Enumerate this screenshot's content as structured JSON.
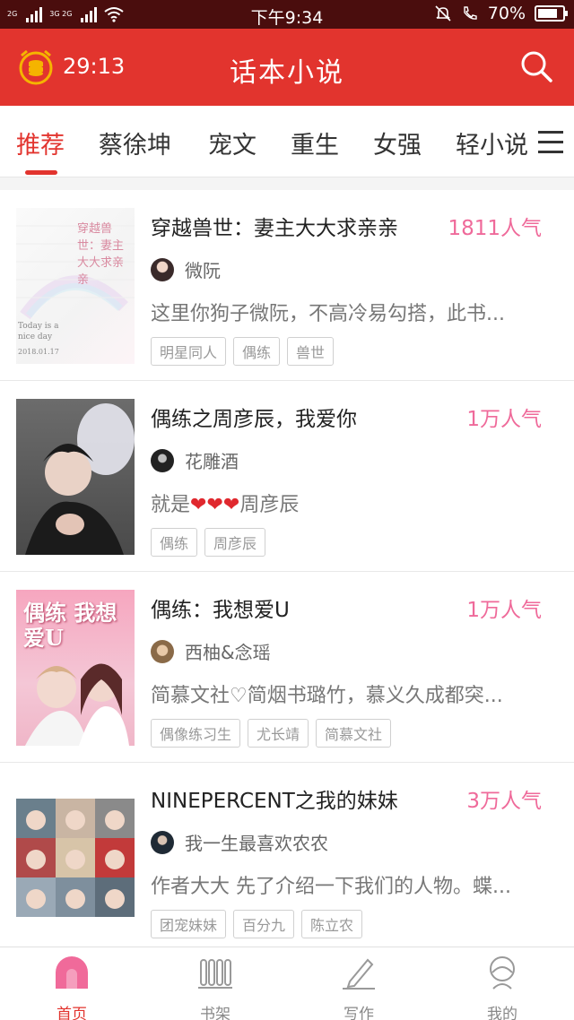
{
  "status": {
    "network_top": "2G",
    "network_bottom": "3G 2G",
    "time": "下午9:34",
    "battery": "70%"
  },
  "header": {
    "timer": "29:13",
    "title": "话本小说"
  },
  "tabs": [
    {
      "label": "推荐",
      "active": true
    },
    {
      "label": "蔡徐坤"
    },
    {
      "label": "宠文"
    },
    {
      "label": "重生"
    },
    {
      "label": "女强"
    },
    {
      "label": "轻小说"
    }
  ],
  "books": [
    {
      "title": "穿越兽世：妻主大大求亲亲",
      "popularity": "1811人气",
      "author": "微阮",
      "desc": "这里你狗子微阮，不高冷易勾搭，此书...",
      "tags": [
        "明星同人",
        "偶练",
        "兽世"
      ],
      "cover_text": [
        "穿越兽世：妻主大大求亲亲",
        "Today is a nice day",
        "2018.01.17"
      ]
    },
    {
      "title": "偶练之周彦辰，我爱你",
      "popularity": "1万人气",
      "author": "花雕酒",
      "desc_prefix": "就是",
      "desc_hearts": "❤❤❤",
      "desc_suffix": "周彦辰",
      "tags": [
        "偶练",
        "周彦辰"
      ]
    },
    {
      "title": "偶练：我想爱U",
      "popularity": "1万人气",
      "author": "西柚&念瑶",
      "desc": "简慕文社♡简烟书璐竹，慕义久成都突...",
      "tags": [
        "偶像练习生",
        "尤长靖",
        "简慕文社"
      ],
      "cover_text": "偶练 我想爱U"
    },
    {
      "title": "NINEPERCENT之我的妹妹",
      "popularity": "3万人气",
      "author": "我一生最喜欢农农",
      "desc": "作者大大 先了介绍一下我们的人物。蝶...",
      "tags": [
        "团宠妹妹",
        "百分九",
        "陈立农"
      ]
    }
  ],
  "nav": [
    {
      "label": "首页",
      "icon": "home-icon",
      "active": true
    },
    {
      "label": "书架",
      "icon": "bookshelf-icon"
    },
    {
      "label": "写作",
      "icon": "pen-icon"
    },
    {
      "label": "我的",
      "icon": "profile-icon"
    }
  ],
  "colors": {
    "brand": "#e2342e",
    "status_bar": "#4a0d0d",
    "popularity": "#ef6a9a",
    "clock": "#f5b400"
  }
}
